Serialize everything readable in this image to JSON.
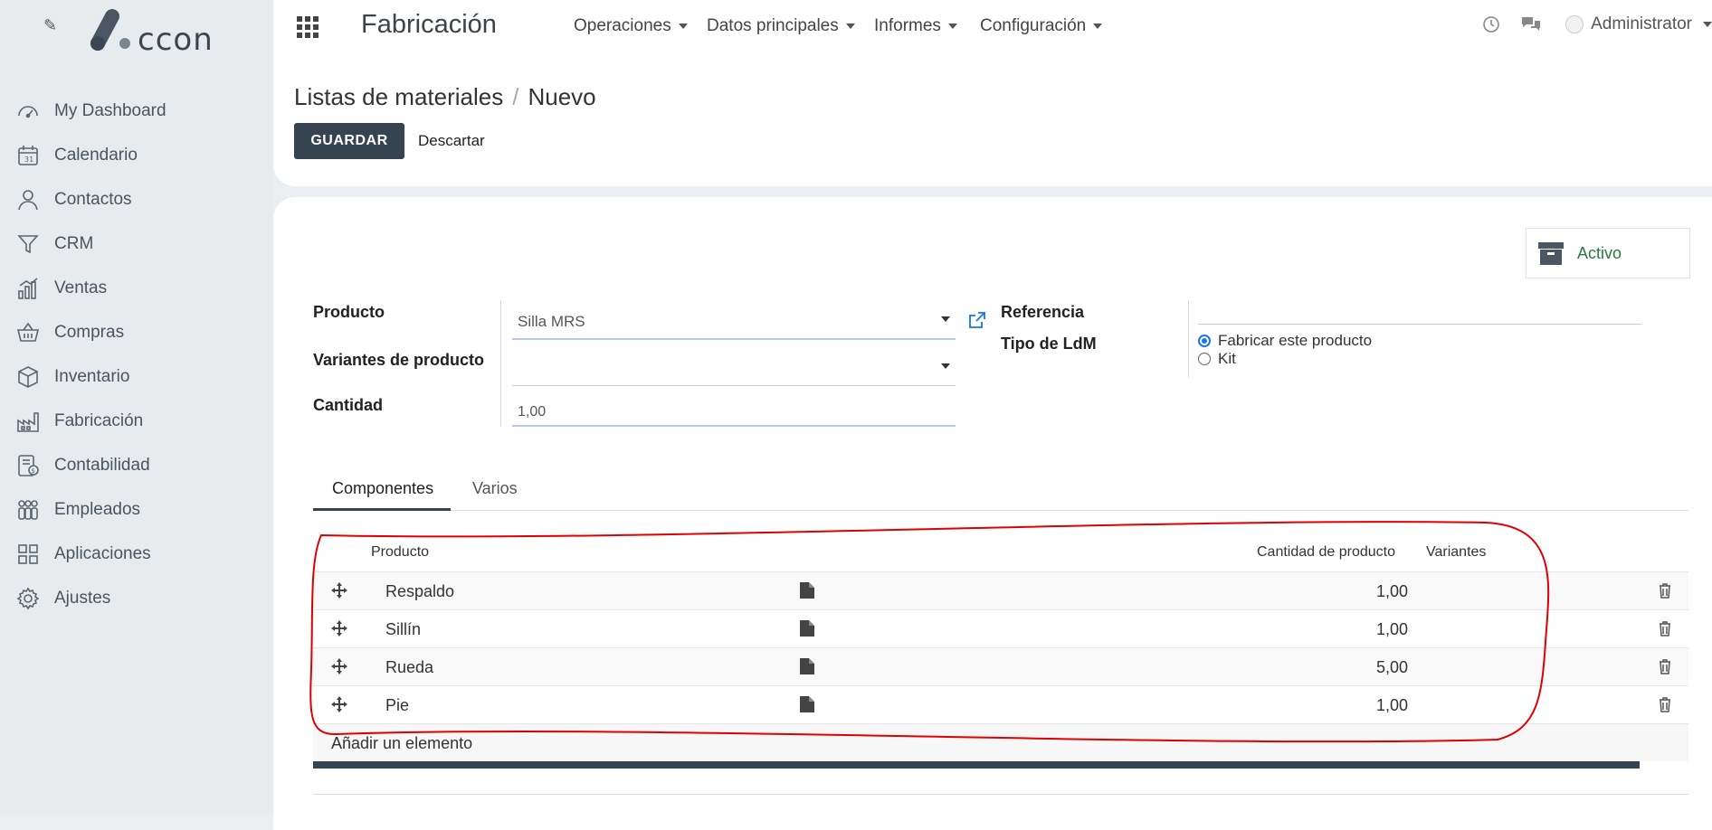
{
  "sidebar": {
    "brand": "ccon",
    "items": [
      {
        "label": "My Dashboard",
        "icon": "dashboard-icon"
      },
      {
        "label": "Calendario",
        "icon": "calendar-icon"
      },
      {
        "label": "Contactos",
        "icon": "contact-icon"
      },
      {
        "label": "CRM",
        "icon": "filter-icon"
      },
      {
        "label": "Ventas",
        "icon": "chart-icon"
      },
      {
        "label": "Compras",
        "icon": "basket-icon"
      },
      {
        "label": "Inventario",
        "icon": "box-icon"
      },
      {
        "label": "Fabricación",
        "icon": "factory-icon"
      },
      {
        "label": "Contabilidad",
        "icon": "accounting-icon"
      },
      {
        "label": "Empleados",
        "icon": "employees-icon"
      },
      {
        "label": "Aplicaciones",
        "icon": "apps-grid-icon"
      },
      {
        "label": "Ajustes",
        "icon": "gear-icon"
      }
    ]
  },
  "topbar": {
    "app_title": "Fabricación",
    "menus": [
      "Operaciones",
      "Datos principales",
      "Informes",
      "Configuración"
    ],
    "user": "Administrator"
  },
  "control": {
    "breadcrumb_parent": "Listas de materiales",
    "breadcrumb_sep": "/",
    "breadcrumb_current": "Nuevo",
    "save_label": "GUARDAR",
    "discard_label": "Descartar"
  },
  "form": {
    "active_label": "Activo",
    "product_label": "Producto",
    "product_value": "Silla MRS",
    "variants_label": "Variantes de producto",
    "variants_value": "",
    "quantity_label": "Cantidad",
    "quantity_value": "1,00",
    "reference_label": "Referencia",
    "reference_value": "",
    "bom_type_label": "Tipo de LdM",
    "bom_type_options": [
      "Fabricar este producto",
      "Kit"
    ],
    "bom_type_selected": "Fabricar este producto"
  },
  "tabs": [
    "Componentes",
    "Varios"
  ],
  "table": {
    "headers": {
      "product": "Producto",
      "quantity": "Cantidad de producto",
      "variants": "Variantes"
    },
    "rows": [
      {
        "product": "Respaldo",
        "quantity": "1,00"
      },
      {
        "product": "Sillín",
        "quantity": "1,00"
      },
      {
        "product": "Rueda",
        "quantity": "5,00"
      },
      {
        "product": "Pie",
        "quantity": "1,00"
      }
    ],
    "add_label": "Añadir un elemento"
  },
  "colors": {
    "primary": "#364350",
    "annotation": "#e00000",
    "link": "#1a73e8",
    "active_text": "#2a7a3b"
  }
}
